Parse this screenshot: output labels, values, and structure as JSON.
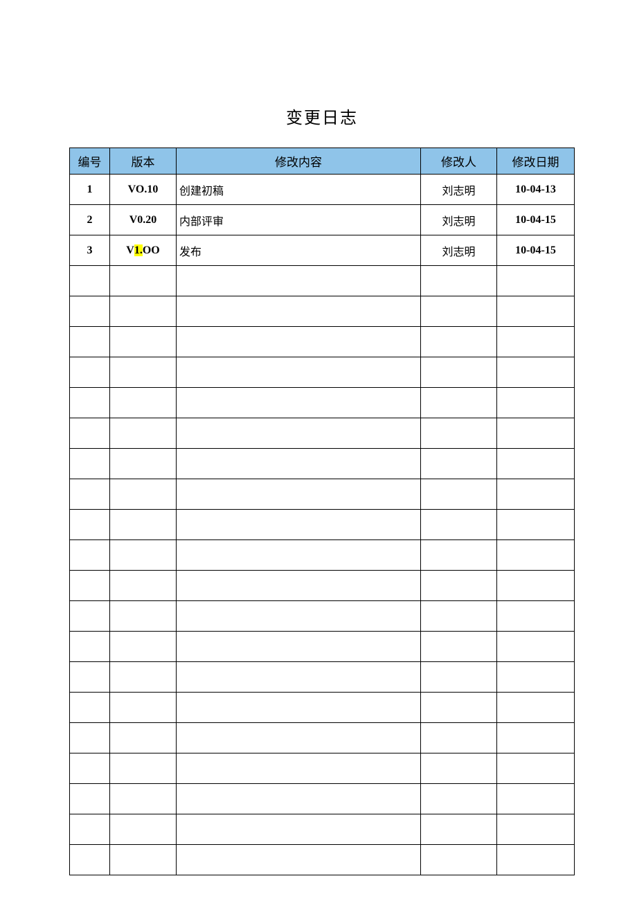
{
  "title": "变更日志",
  "headers": {
    "id": "编号",
    "version": "版本",
    "content": "修改内容",
    "author": "修改人",
    "date": "修改日期"
  },
  "rows": [
    {
      "id": "1",
      "version": "VO.10",
      "version_html": "VO.10",
      "content": "创建初稿",
      "author": "刘志明",
      "date": "10-04-13"
    },
    {
      "id": "2",
      "version": "V0.20",
      "version_html": "V0.20",
      "content": "内部评审",
      "author": "刘志明",
      "date": "10-04-15"
    },
    {
      "id": "3",
      "version": "V1.OO",
      "version_html": "V<span class=\"hl\">1.</span>OO",
      "content": "发布",
      "author": "刘志明",
      "date": "10-04-15"
    }
  ],
  "empty_row_count": 20
}
